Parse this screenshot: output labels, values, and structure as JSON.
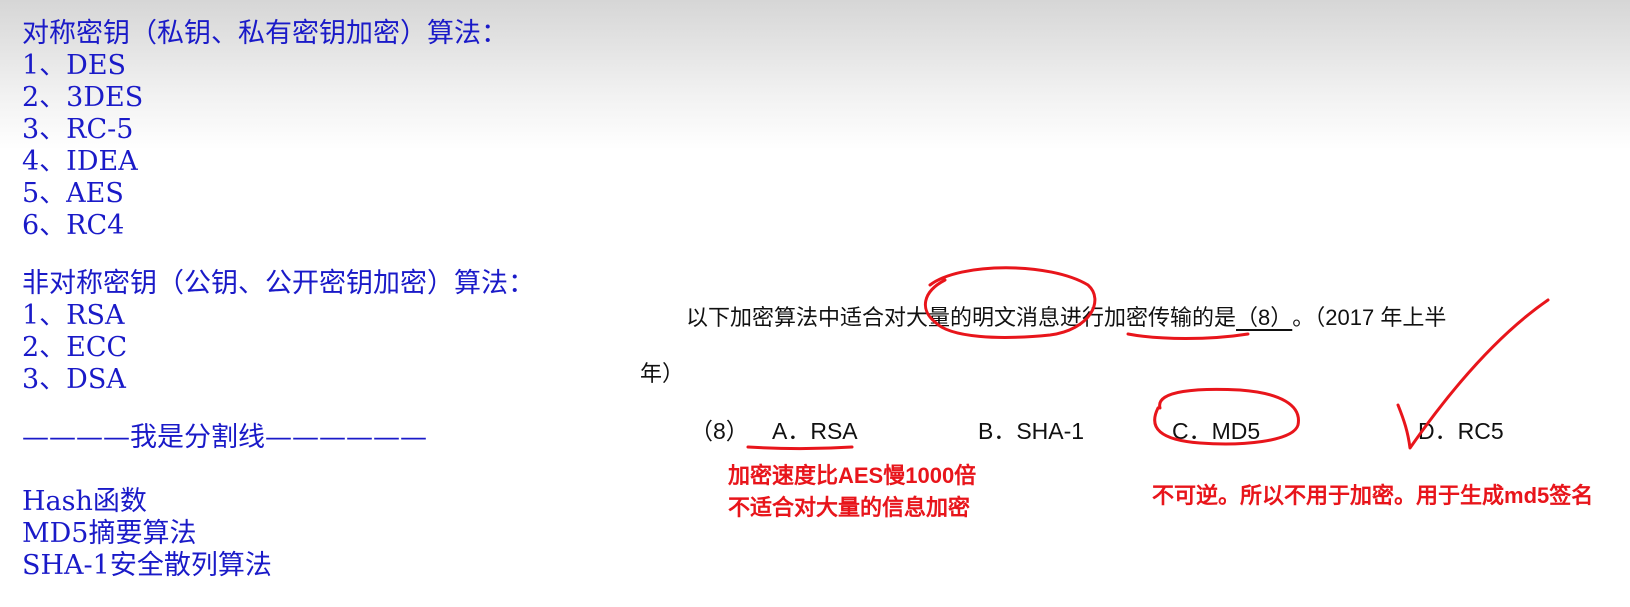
{
  "notes": {
    "symmetric_title": "对称密钥（私钥、私有密钥加密）算法：",
    "symmetric_items": [
      "1、DES",
      "2、3DES",
      "3、RC-5",
      "4、IDEA",
      "5、AES",
      "6、RC4"
    ],
    "asymmetric_title": "非对称密钥（公钥、公开密钥加密）算法：",
    "asymmetric_items": [
      "1、RSA",
      "2、ECC",
      "3、DSA"
    ],
    "divider": "————我是分割线——————",
    "hash_items": [
      "Hash函数",
      "MD5摘要算法",
      "SHA-1安全散列算法"
    ]
  },
  "question": {
    "text": "以下加密算法中适合对大量的明文消息进行加密传输的是",
    "blank": "（8）  ",
    "suffix": "。（2017 年上半",
    "line2": "年）",
    "number": "（8）",
    "options": [
      "A．RSA",
      "B．SHA-1",
      "C．MD5",
      "D．RC5"
    ]
  },
  "annotations": {
    "rsa_note_1": "加密速度比AES慢1000倍",
    "rsa_note_2": "不适合对大量的信息加密",
    "md5_note": "不可逆。所以不用于加密。用于生成md5签名",
    "ink_color": "#e8151b"
  }
}
